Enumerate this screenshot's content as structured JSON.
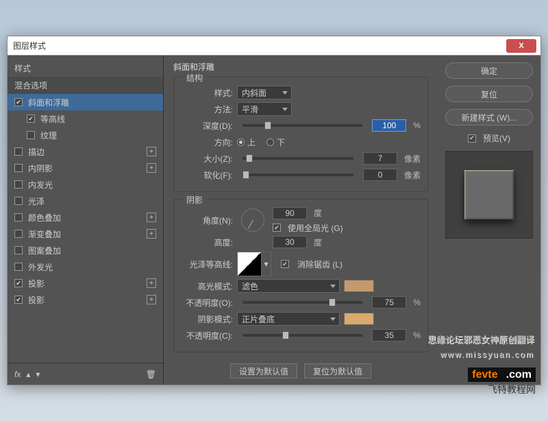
{
  "window": {
    "title": "图层样式"
  },
  "left": {
    "styles_header": "样式",
    "blend": "混合选项",
    "items": [
      {
        "label": "斜面和浮雕",
        "checked": true,
        "selected": true,
        "add": false,
        "sub": false
      },
      {
        "label": "等高线",
        "checked": true,
        "selected": false,
        "add": false,
        "sub": true
      },
      {
        "label": "纹理",
        "checked": false,
        "selected": false,
        "add": false,
        "sub": true
      },
      {
        "label": "描边",
        "checked": false,
        "selected": false,
        "add": true,
        "sub": false
      },
      {
        "label": "内阴影",
        "checked": false,
        "selected": false,
        "add": true,
        "sub": false
      },
      {
        "label": "内发光",
        "checked": false,
        "selected": false,
        "add": false,
        "sub": false
      },
      {
        "label": "光泽",
        "checked": false,
        "selected": false,
        "add": false,
        "sub": false
      },
      {
        "label": "颜色叠加",
        "checked": false,
        "selected": false,
        "add": true,
        "sub": false
      },
      {
        "label": "渐变叠加",
        "checked": false,
        "selected": false,
        "add": true,
        "sub": false
      },
      {
        "label": "图案叠加",
        "checked": false,
        "selected": false,
        "add": false,
        "sub": false
      },
      {
        "label": "外发光",
        "checked": false,
        "selected": false,
        "add": false,
        "sub": false
      },
      {
        "label": "投影",
        "checked": true,
        "selected": false,
        "add": true,
        "sub": false
      },
      {
        "label": "投影",
        "checked": true,
        "selected": false,
        "add": true,
        "sub": false
      }
    ],
    "fx_label": "fx"
  },
  "mid": {
    "title": "斜面和浮雕",
    "structure": {
      "legend": "结构",
      "style_label": "样式:",
      "style_val": "内斜面",
      "technique_label": "方法:",
      "technique_val": "平滑",
      "depth_label": "深度(D):",
      "depth_val": "100",
      "depth_unit": "%",
      "direction_label": "方向:",
      "up": "上",
      "down": "下",
      "size_label": "大小(Z):",
      "size_val": "7",
      "size_unit": "像素",
      "soften_label": "软化(F):",
      "soften_val": "0",
      "soften_unit": "像素"
    },
    "shading": {
      "legend": "阴影",
      "angle_label": "角度(N):",
      "angle_val": "90",
      "angle_unit": "度",
      "global_label": "使用全局光 (G)",
      "altitude_label": "高度:",
      "altitude_val": "30",
      "altitude_unit": "度",
      "gloss_label": "光泽等高线:",
      "antialias_label": "消除锯齿 (L)",
      "highlight_mode_label": "高光模式:",
      "highlight_mode_val": "滤色",
      "highlight_color": "#c49a6c",
      "highlight_op_label": "不透明度(O):",
      "highlight_op_val": "75",
      "op_unit": "%",
      "shadow_mode_label": "阴影模式:",
      "shadow_mode_val": "正片叠底",
      "shadow_color": "#d9a96e",
      "shadow_op_label": "不透明度(C):",
      "shadow_op_val": "35"
    },
    "make_default": "设置为默认值",
    "reset_default": "复位为默认值"
  },
  "right": {
    "ok": "确定",
    "cancel": "复位",
    "newstyle": "新建样式 (W)...",
    "preview": "预览(V)"
  },
  "watermark": {
    "line1": "思缘论坛邪恶女神原创翻译",
    "line2": "www.missyuan.com",
    "logo1": "fevte",
    "logo2": ".com",
    "logo3": "飞特教程网"
  }
}
